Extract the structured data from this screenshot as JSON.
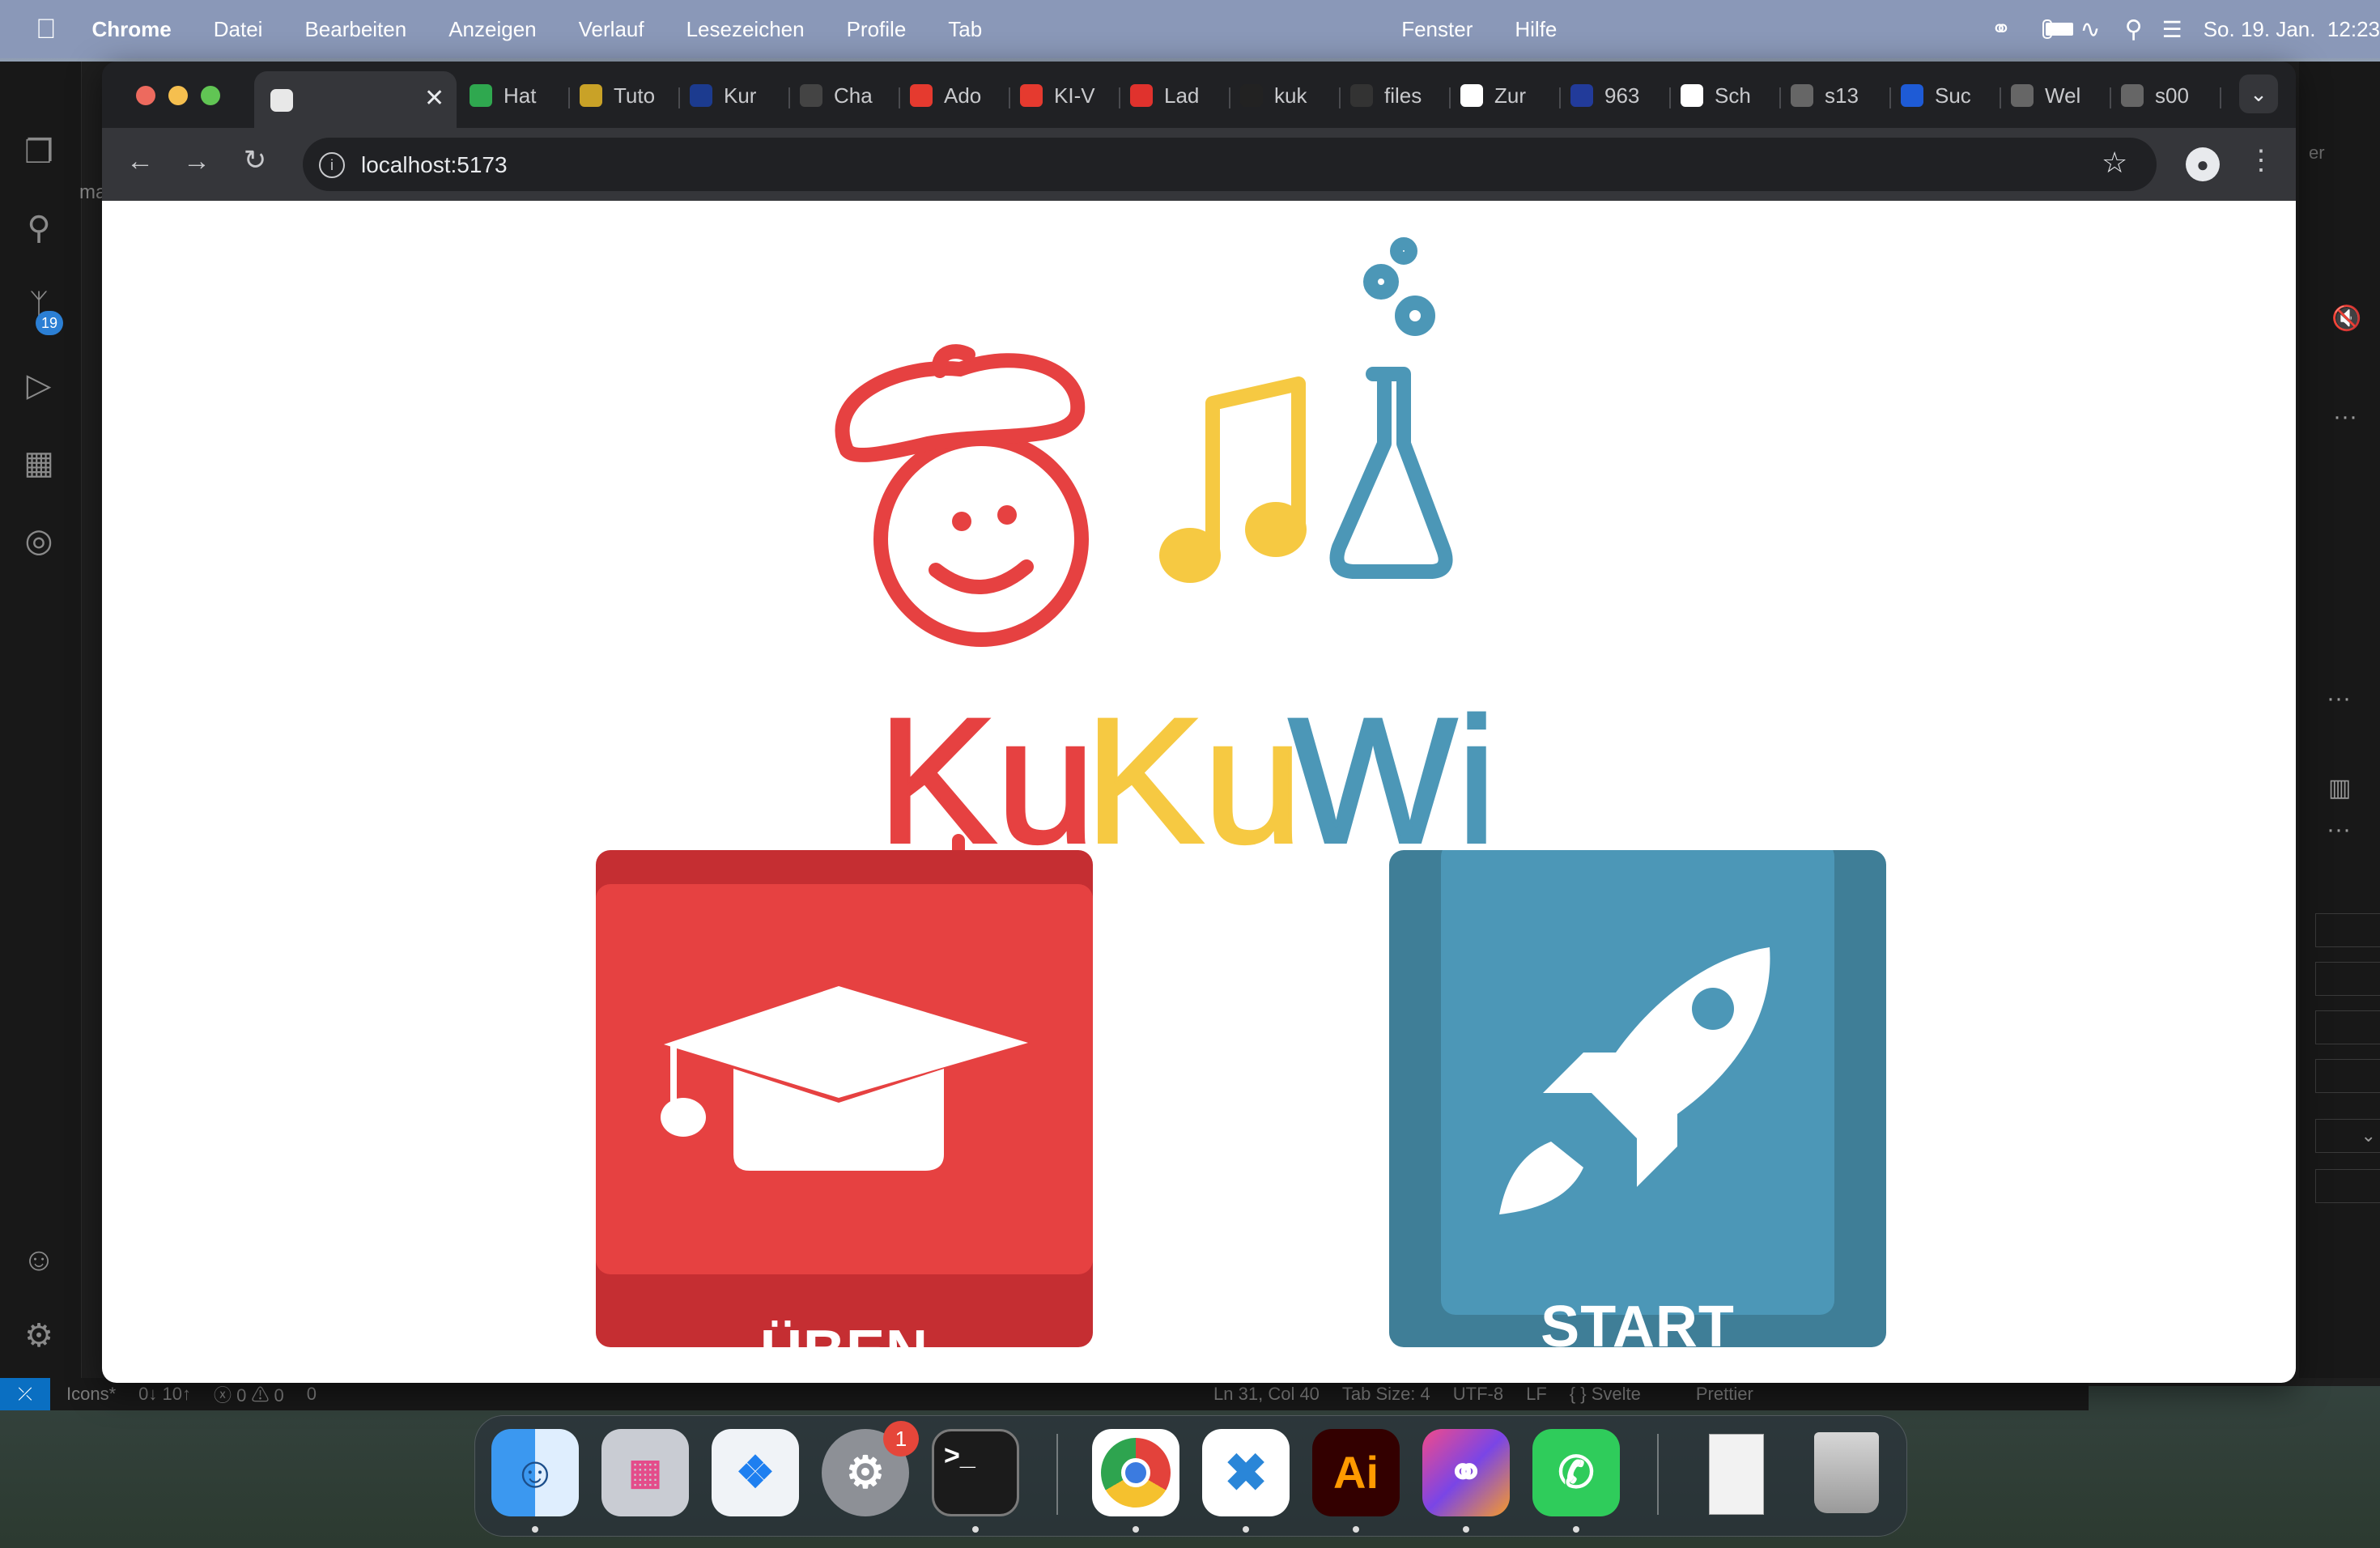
{
  "menubar": {
    "app_name": "Chrome",
    "items": [
      "Datei",
      "Bearbeiten",
      "Anzeigen",
      "Verlauf",
      "Lesezeichen",
      "Profile",
      "Tab",
      "Fenster",
      "Hilfe"
    ],
    "datetime": "So. 19. Jan.  12:23"
  },
  "vscode": {
    "scm_badge": "19",
    "fragment_left": "ma",
    "fragment_right": "er",
    "status": {
      "branch": "Icons*",
      "sync": "0↓ 10↑",
      "problems": "ⓧ 0 ⚠ 0",
      "ports": "0",
      "position": "Ln 31, Col 40",
      "tab_size": "Tab Size: 4",
      "encoding": "UTF-8",
      "eol": "LF",
      "language": "{ } Svelte",
      "formatter": "Prettier"
    }
  },
  "chrome": {
    "tabs": [
      {
        "label": "Hat"
      },
      {
        "label": "Tuto"
      },
      {
        "label": "Kur"
      },
      {
        "label": "Cha"
      },
      {
        "label": "Ado"
      },
      {
        "label": "KI-V"
      },
      {
        "label": "Lad"
      },
      {
        "label": "kuk"
      },
      {
        "label": "files"
      },
      {
        "label": "Zur"
      },
      {
        "label": "963"
      },
      {
        "label": "Sch"
      },
      {
        "label": "s13"
      },
      {
        "label": "Suc"
      },
      {
        "label": "Wel"
      },
      {
        "label": "s00"
      }
    ],
    "url": "localhost:5173"
  },
  "page": {
    "logo": {
      "ku1": "Ku",
      "ku2": "Ku",
      "wi": "Wi"
    },
    "learn_button_label": "ÜBEN",
    "start_button_label": "START",
    "colors": {
      "red": "#e64141",
      "dark_red": "#c52e32",
      "yellow": "#f6c942",
      "blue": "#4c97b7",
      "dark_blue": "#3f7e97"
    }
  },
  "dock": {
    "apps": [
      "Finder",
      "Launchpad",
      "Safari",
      "Systemeinstellungen",
      "Terminal",
      "Chrome",
      "Visual Studio Code",
      "Illustrator",
      "Creative Cloud",
      "WhatsApp",
      "Dokumente",
      "Papierkorb"
    ],
    "settings_badge": "1"
  }
}
